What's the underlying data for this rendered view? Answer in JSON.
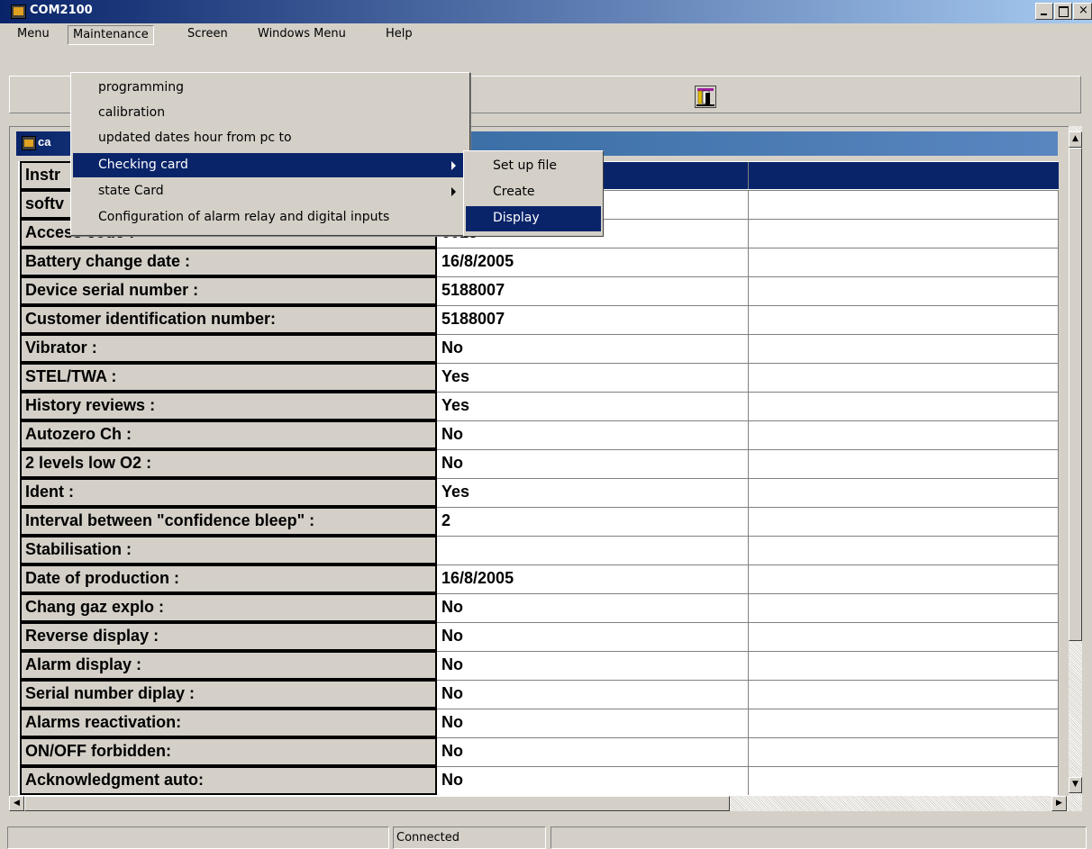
{
  "window": {
    "title": "COM2100",
    "close_glyph": "×"
  },
  "menubar": {
    "items": [
      {
        "label": "Menu"
      },
      {
        "label": "Maintenance"
      },
      {
        "label": "Screen"
      },
      {
        "label": "Windows Menu"
      },
      {
        "label": "Help"
      }
    ]
  },
  "maintenance_menu": {
    "items": [
      {
        "label": "programming"
      },
      {
        "label": "calibration"
      },
      {
        "label": "updated dates hour from pc to"
      },
      {
        "label": "Checking card"
      },
      {
        "label": "state Card"
      },
      {
        "label": "Configuration of alarm relay and digital inputs"
      }
    ]
  },
  "checking_card_submenu": {
    "items": [
      {
        "label": "Set up file"
      },
      {
        "label": "Create"
      },
      {
        "label": "Display"
      }
    ]
  },
  "child_window": {
    "title": "ca"
  },
  "grid": {
    "header_label": "Instr",
    "rows": [
      {
        "label": "softv",
        "value": ""
      },
      {
        "label": "Access code :",
        "value": "0018"
      },
      {
        "label": "Battery change date :",
        "value": "16/8/2005"
      },
      {
        "label": "Device serial number :",
        "value": "5188007"
      },
      {
        "label": "Customer identification number:",
        "value": "5188007"
      },
      {
        "label": "Vibrator :",
        "value": "No"
      },
      {
        "label": "STEL/TWA :",
        "value": "Yes"
      },
      {
        "label": "History reviews :",
        "value": "Yes"
      },
      {
        "label": "Autozero Ch :",
        "value": "No"
      },
      {
        "label": "2 levels low O2 :",
        "value": "No"
      },
      {
        "label": "Ident :",
        "value": "Yes"
      },
      {
        "label": "Interval between \"confidence bleep\" :",
        "value": "2"
      },
      {
        "label": "Stabilisation :",
        "value": ""
      },
      {
        "label": "Date of production :",
        "value": "16/8/2005"
      },
      {
        "label": "Chang gaz explo :",
        "value": "No"
      },
      {
        "label": "Reverse display :",
        "value": "No"
      },
      {
        "label": "Alarm display :",
        "value": "No"
      },
      {
        "label": "Serial number diplay :",
        "value": "No"
      },
      {
        "label": "Alarms reactivation:",
        "value": "No"
      },
      {
        "label": "ON/OFF forbidden:",
        "value": "No"
      },
      {
        "label": "Acknowledgment auto:",
        "value": "No"
      }
    ]
  },
  "scroll": {
    "up": "▲",
    "down": "▼",
    "left": "◀",
    "right": "▶"
  },
  "statusbar": {
    "panels": [
      "",
      "Connected",
      ""
    ]
  },
  "icons": {
    "app": "app-icon",
    "toolbar_exit": "door-exit-icon",
    "child": "child-window-icon"
  },
  "colors": {
    "selection": "#0a246a",
    "face": "#d4d0c8"
  }
}
